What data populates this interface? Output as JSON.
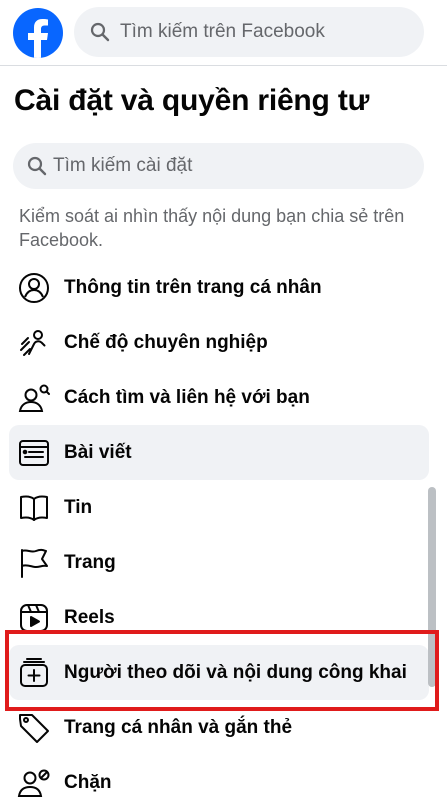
{
  "header": {
    "brand_color": "#0866ff",
    "logo_icon": "facebook-f-icon",
    "search_placeholder": "Tìm kiếm trên Facebook"
  },
  "page": {
    "title": "Cài đặt và quyền riêng tư",
    "search_placeholder": "Tìm kiếm cài đặt",
    "section_description": "Kiểm soát ai nhìn thấy nội dung bạn chia sẻ trên Facebook."
  },
  "menu": [
    {
      "label": "Thông tin trên trang cá nhân",
      "icon": "profile-circle-icon",
      "active": false
    },
    {
      "label": "Chế độ chuyên nghiệp",
      "icon": "professional-mode-icon",
      "active": false
    },
    {
      "label": "Cách tìm và liên hệ với bạn",
      "icon": "find-contact-icon",
      "active": false
    },
    {
      "label": "Bài viết",
      "icon": "posts-icon",
      "active": true
    },
    {
      "label": "Tin",
      "icon": "stories-icon",
      "active": false
    },
    {
      "label": "Trang",
      "icon": "pages-flag-icon",
      "active": false
    },
    {
      "label": "Reels",
      "icon": "reels-icon",
      "active": false
    },
    {
      "label": "Người theo dõi và nội dung công khai",
      "icon": "followers-icon",
      "active": true,
      "highlighted": true
    },
    {
      "label": "Trang cá nhân và gắn thẻ",
      "icon": "tag-icon",
      "active": false
    },
    {
      "label": "Chặn",
      "icon": "block-user-icon",
      "active": false
    }
  ],
  "colors": {
    "highlight_border": "#e01b1b",
    "active_row_bg": "#f0f2f5"
  }
}
